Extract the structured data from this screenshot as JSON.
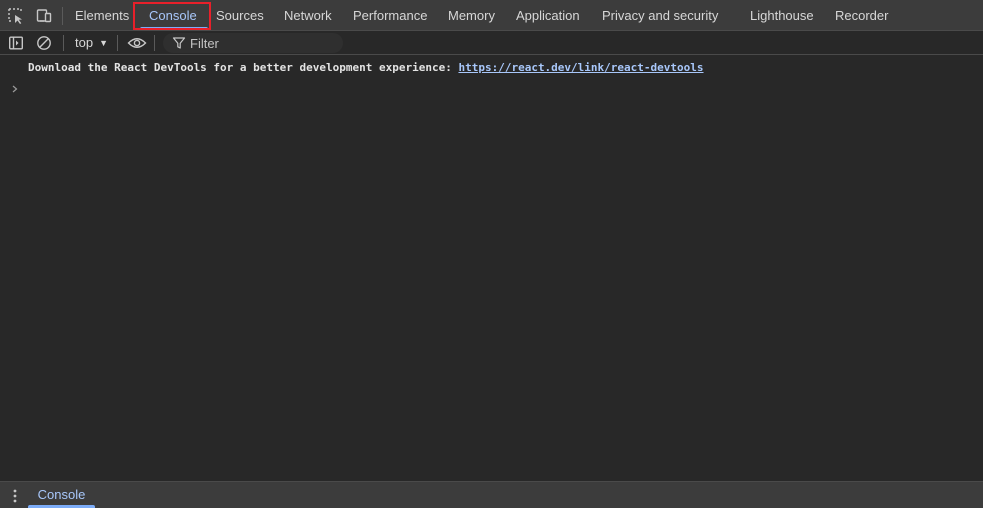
{
  "tabbar": {
    "tabs": [
      {
        "label": "Elements"
      },
      {
        "label": "Console"
      },
      {
        "label": "Sources"
      },
      {
        "label": "Network"
      },
      {
        "label": "Performance"
      },
      {
        "label": "Memory"
      },
      {
        "label": "Application"
      },
      {
        "label": "Privacy and security"
      },
      {
        "label": "Lighthouse"
      },
      {
        "label": "Recorder"
      }
    ],
    "active_tab": "Console",
    "icons": [
      "inspect-element-icon",
      "device-toolbar-icon"
    ]
  },
  "toolbar": {
    "context": "top",
    "filter_placeholder": "Filter",
    "icons": [
      "sidebar-toggle-icon",
      "clear-console-icon",
      "live-expression-eye-icon",
      "filter-icon"
    ]
  },
  "console": {
    "message_text": "Download the React DevTools for a better development experience: ",
    "message_link": "https://react.dev/link/react-devtools"
  },
  "drawer": {
    "tab_label": "Console"
  },
  "colors": {
    "accent": "#a8c7fa",
    "highlight_border": "#e8202a",
    "background": "#282828",
    "toolbar_background": "#3c3c3c"
  }
}
